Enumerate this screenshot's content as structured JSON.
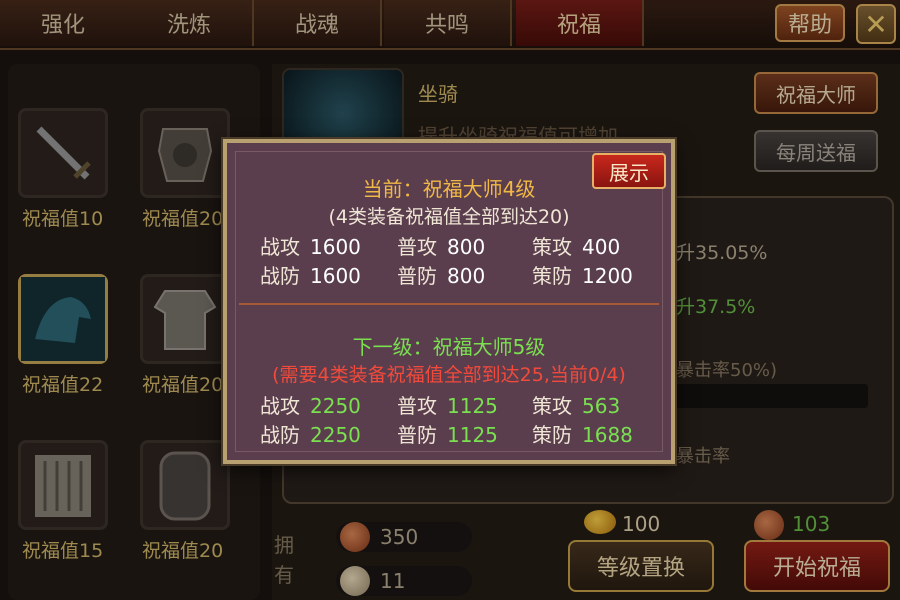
{
  "tabs": [
    "强化",
    "洗炼",
    "战魂",
    "共鸣",
    "祝福"
  ],
  "active_tab_index": 4,
  "header": {
    "help_label": "帮助",
    "close_glyph": "✕"
  },
  "equipment": [
    {
      "icon": "sword-icon",
      "value_label": "祝福值10"
    },
    {
      "icon": "armor-icon",
      "value_label": "祝福值20"
    },
    {
      "icon": "mount-icon",
      "value_label": "祝福值22",
      "selected": true
    },
    {
      "icon": "robe-icon",
      "value_label": "祝福值20"
    },
    {
      "icon": "scroll-icon",
      "value_label": "祝福值15"
    },
    {
      "icon": "token-icon",
      "value_label": "祝福值20"
    }
  ],
  "mount": {
    "title": "坐骑",
    "desc": "提升坐骑祝福值可增加"
  },
  "buttons": {
    "master": "祝福大师",
    "weekly": "每周送福",
    "swap": "等级置换",
    "start": "开始祝福"
  },
  "background_stats": {
    "line1": "升35.05%",
    "line2": "升37.5%",
    "line3": "暴击率50%)",
    "line4": "暴击率"
  },
  "owned": {
    "label": "拥有",
    "res1": "350",
    "res2": "11",
    "gold": "100",
    "talisman": "103"
  },
  "popup": {
    "show_button": "展示",
    "current_title": "当前：祝福大师4级",
    "current_req": "(4类装备祝福值全部到达20)",
    "current_stats": [
      {
        "label": "战攻",
        "value": "1600"
      },
      {
        "label": "普攻",
        "value": "800"
      },
      {
        "label": "策攻",
        "value": "400"
      },
      {
        "label": "战防",
        "value": "1600"
      },
      {
        "label": "普防",
        "value": "800"
      },
      {
        "label": "策防",
        "value": "1200"
      }
    ],
    "next_title": "下一级：祝福大师5级",
    "next_req": "(需要4类装备祝福值全部到达25,当前0/4)",
    "next_stats": [
      {
        "label": "战攻",
        "value": "2250"
      },
      {
        "label": "普攻",
        "value": "1125"
      },
      {
        "label": "策攻",
        "value": "563"
      },
      {
        "label": "战防",
        "value": "2250"
      },
      {
        "label": "普防",
        "value": "1125"
      },
      {
        "label": "策防",
        "value": "1688"
      }
    ]
  },
  "colors": {
    "accent_gold": "#f0b846",
    "next_green": "#7ae050",
    "warning_red": "#f24a3a"
  }
}
